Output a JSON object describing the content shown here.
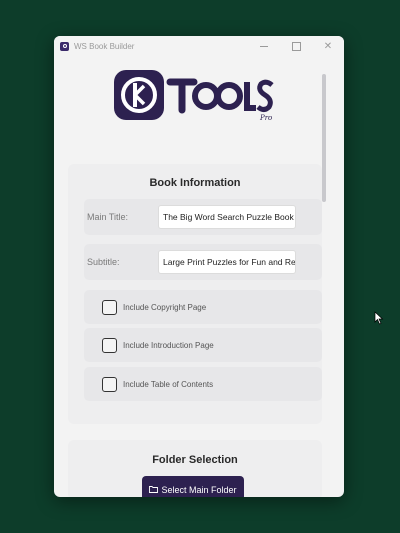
{
  "window": {
    "title": "WS Book Builder"
  },
  "logo": {
    "letters": "TOOLS",
    "suffix": "Pro",
    "brand_color": "#2d2150"
  },
  "book_info": {
    "heading": "Book Information",
    "main_title_label": "Main Title:",
    "main_title_value": "The Big Word Search Puzzle Book",
    "subtitle_label": "Subtitle:",
    "subtitle_value": "Large Print Puzzles for Fun and Relaxation",
    "checkboxes": [
      {
        "label": "Include Copyright Page",
        "checked": false
      },
      {
        "label": "Include Introduction Page",
        "checked": false
      },
      {
        "label": "Include Table of Contents",
        "checked": false
      }
    ]
  },
  "folder": {
    "heading": "Folder Selection",
    "button_label": "Select Main Folder",
    "button_icon": "folder-icon"
  },
  "colors": {
    "desktop": "#0d3d2a",
    "accent": "#2d2150"
  }
}
